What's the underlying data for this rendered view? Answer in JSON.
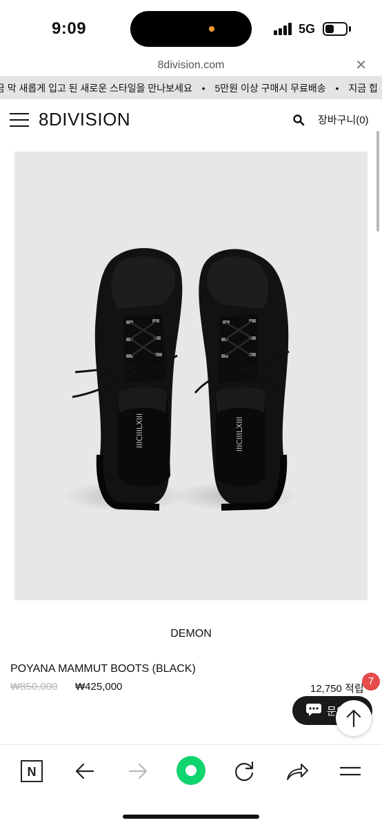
{
  "status_bar": {
    "time": "9:09",
    "network": "5G",
    "signal_icon": "signal-bars-icon",
    "battery_icon": "battery-icon",
    "dot_color": "#f29a2e"
  },
  "browser": {
    "url": "8division.com",
    "close_glyph": "✕"
  },
  "announcement": {
    "items": [
      "금 막 새롭게 입고 된 새로운 스타일을 만나보세요",
      "5만원 이상 구매시 무료배송",
      "지금 힙"
    ],
    "separator": "•"
  },
  "header": {
    "logo": "8DIVISION",
    "cart_label": "장바구니(0)",
    "menu_icon": "hamburger-icon",
    "search_icon": "search-icon"
  },
  "product": {
    "brand": "DEMON",
    "name": "POYANA MAMMUT BOOTS (BLACK)",
    "price_original": "₩850,000",
    "price_sale": "₩425,000",
    "points": "12,750 적립",
    "image_bg": "#e7e7e7",
    "insole_text": "IIICIIILXIII"
  },
  "floating": {
    "badge_count": "7",
    "inquiry_label": "문의",
    "badge_color": "#e54b4b"
  },
  "toolbar": {
    "icons": [
      "naver-home-icon",
      "back-arrow-icon",
      "forward-arrow-icon",
      "green-dot-icon",
      "refresh-icon",
      "share-icon",
      "menu-icon"
    ],
    "naver_letter": "N",
    "accent": "#10d46e"
  }
}
